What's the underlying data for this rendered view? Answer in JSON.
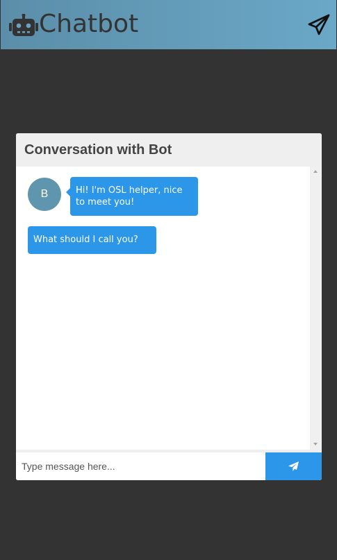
{
  "app": {
    "title": "Chatbot",
    "logo_icon": "robot-icon",
    "header_action_icon": "paper-plane-icon"
  },
  "chat": {
    "title": "Conversation with Bot",
    "bot_avatar_initial": "B",
    "messages": [
      {
        "text": "Hi! I'm OSL helper, nice to meet you!",
        "with_avatar": true
      },
      {
        "text": "What should I call you?",
        "with_avatar": false
      }
    ]
  },
  "composer": {
    "placeholder": "Type message here...",
    "value": "",
    "send_icon": "paper-plane-icon"
  },
  "colors": {
    "background": "#333333",
    "header_gradient_start": "#5b8ea9",
    "header_gradient_end": "#6aa8c7",
    "bubble": "#2c96e8",
    "avatar": "#5f96ae",
    "send_button": "#2c96e8"
  }
}
